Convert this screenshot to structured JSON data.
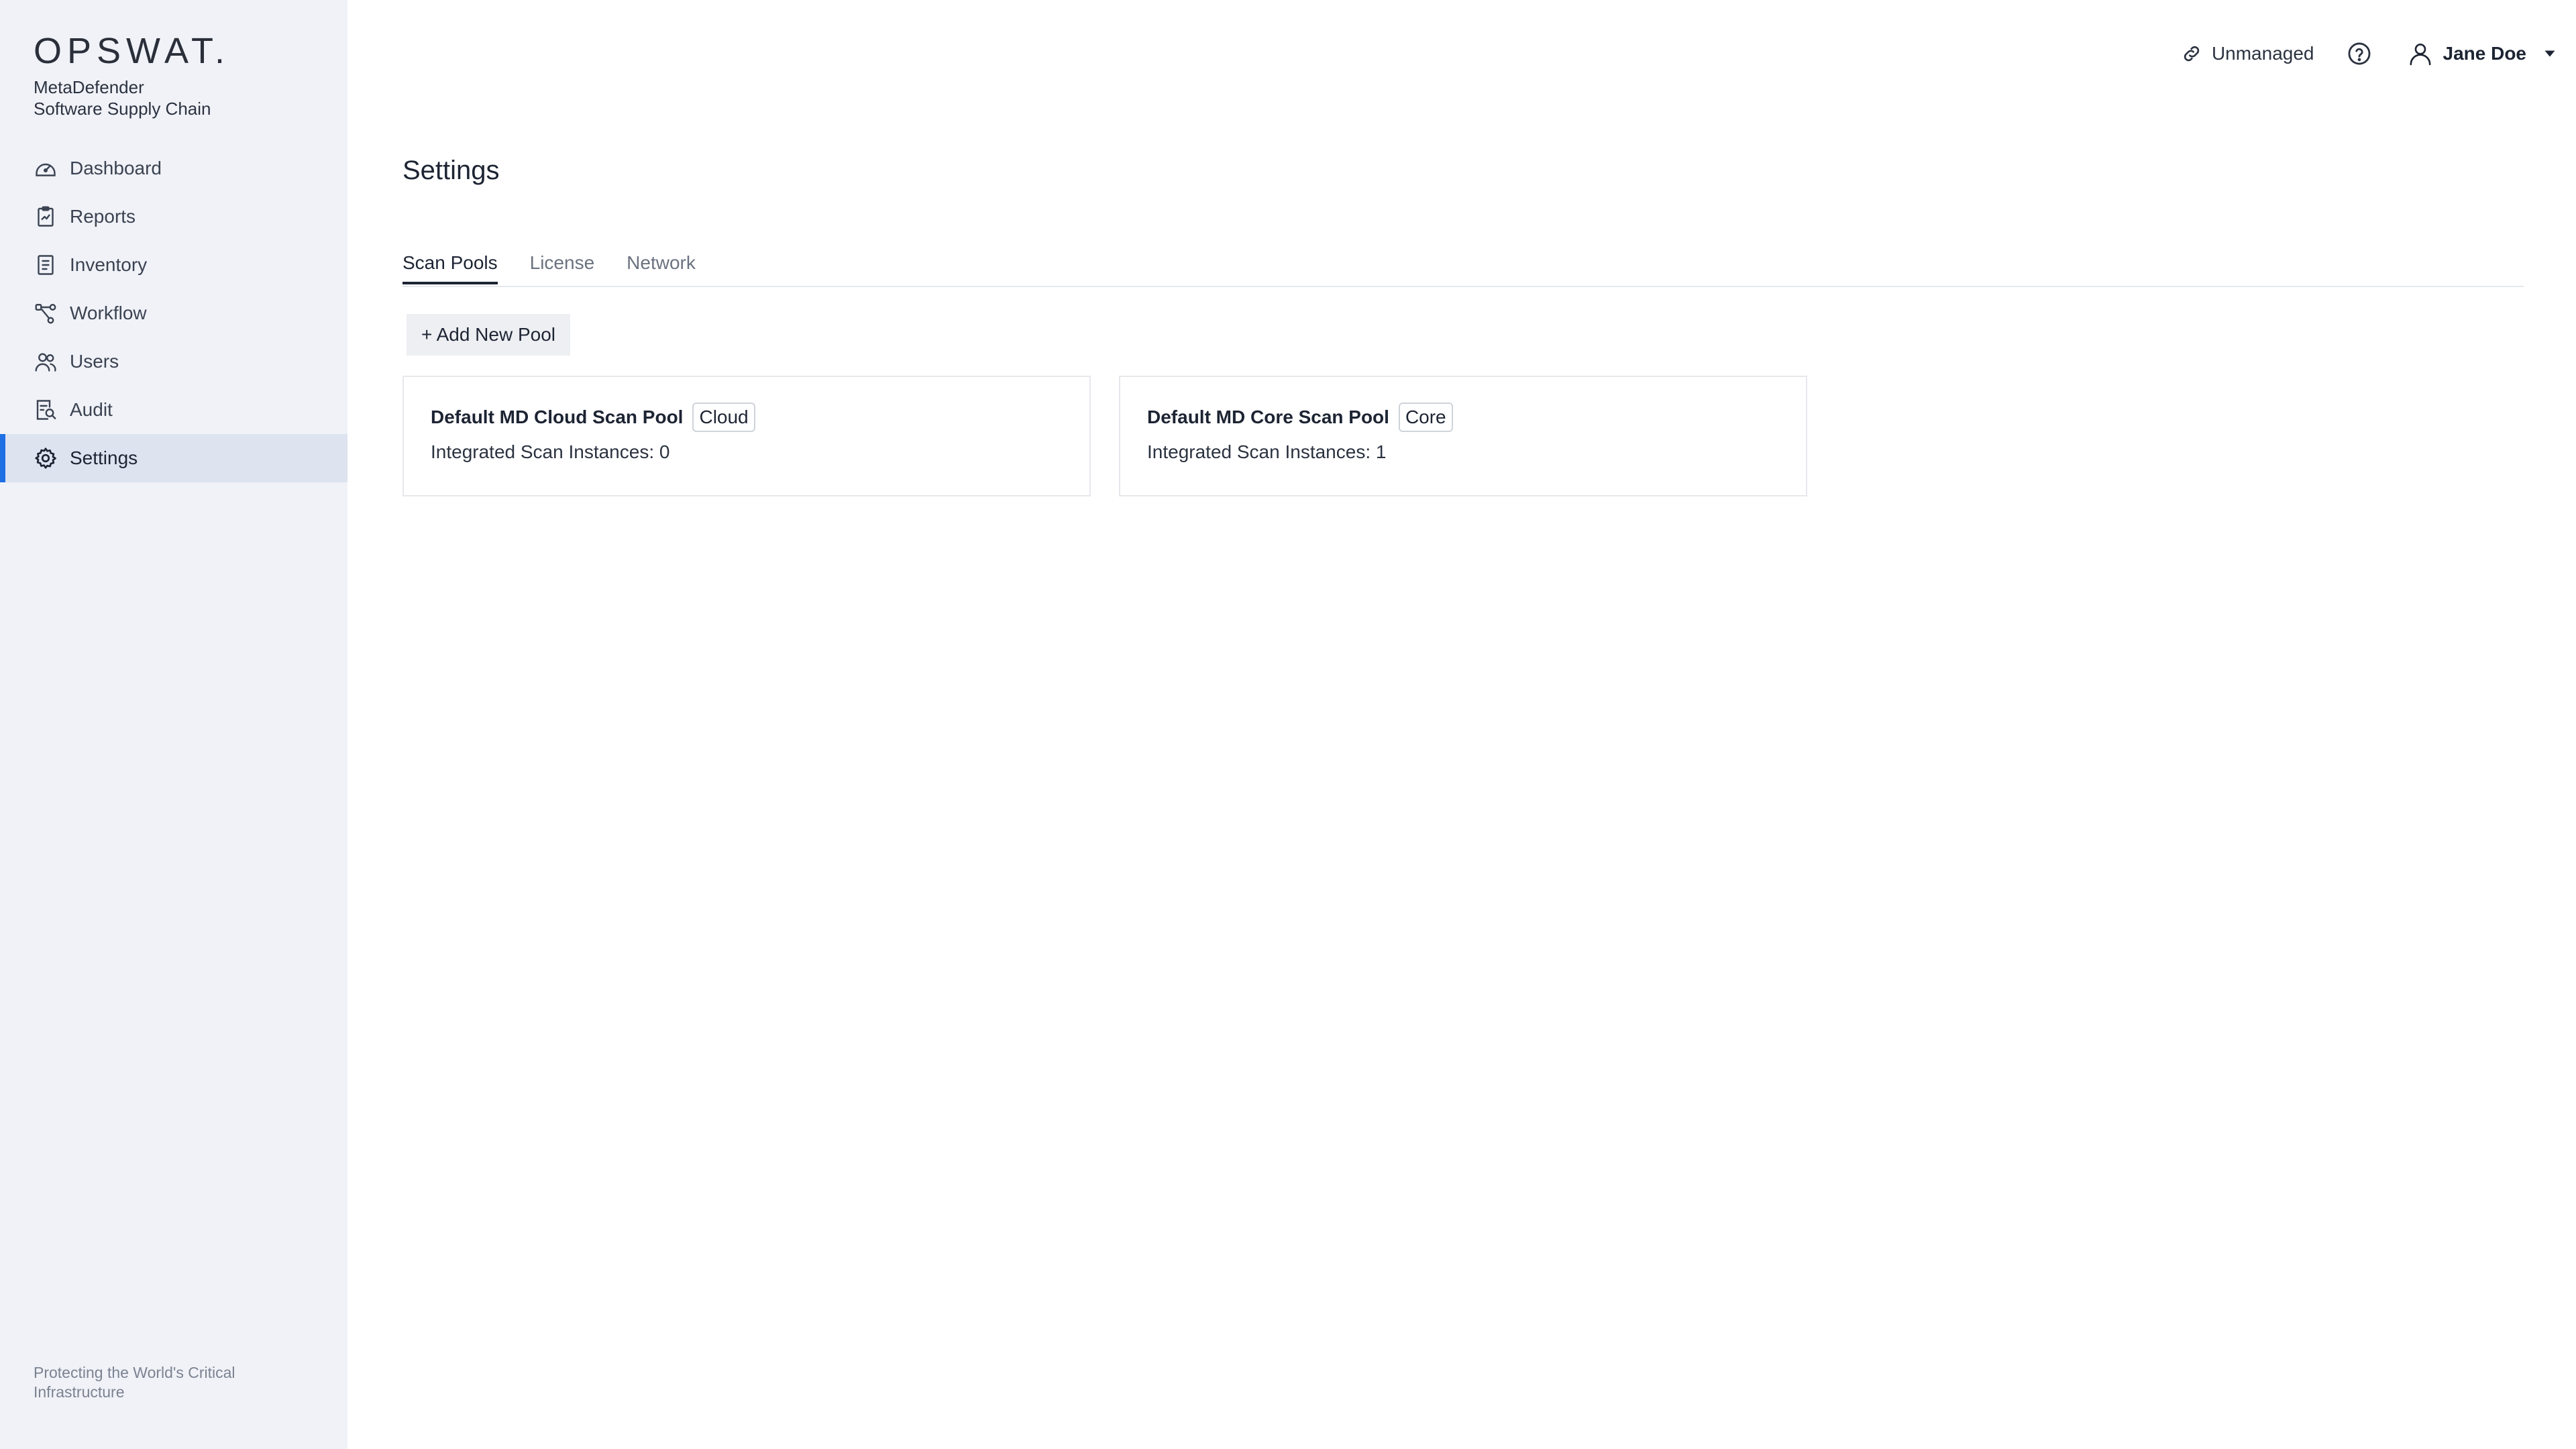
{
  "brand": {
    "logo": "OPSWAT.",
    "product_line1": "MetaDefender",
    "product_line2": "Software Supply Chain"
  },
  "sidebar": {
    "items": [
      {
        "label": "Dashboard",
        "icon": "dashboard-gauge-icon"
      },
      {
        "label": "Reports",
        "icon": "reports-clipboard-icon"
      },
      {
        "label": "Inventory",
        "icon": "inventory-list-icon"
      },
      {
        "label": "Workflow",
        "icon": "workflow-nodes-icon"
      },
      {
        "label": "Users",
        "icon": "users-group-icon"
      },
      {
        "label": "Audit",
        "icon": "audit-doc-icon"
      },
      {
        "label": "Settings",
        "icon": "gear-icon",
        "active": true
      }
    ],
    "footer": "Protecting the World's Critical Infrastructure"
  },
  "topbar": {
    "status": "Unmanaged",
    "user": "Jane Doe"
  },
  "page": {
    "title": "Settings",
    "tabs": [
      "Scan Pools",
      "License",
      "Network"
    ],
    "active_tab": "Scan Pools",
    "add_button": "+ Add New Pool"
  },
  "pools": [
    {
      "name": "Default MD Cloud Scan Pool",
      "badge": "Cloud",
      "instances": "Integrated Scan Instances: 0"
    },
    {
      "name": "Default MD Core Scan Pool",
      "badge": "Core",
      "instances": "Integrated Scan Instances: 1"
    }
  ],
  "colors": {
    "accent": "#1d6fe3",
    "sidebar_bg": "#f0f2f7",
    "active_item_bg": "#dde3ef"
  }
}
